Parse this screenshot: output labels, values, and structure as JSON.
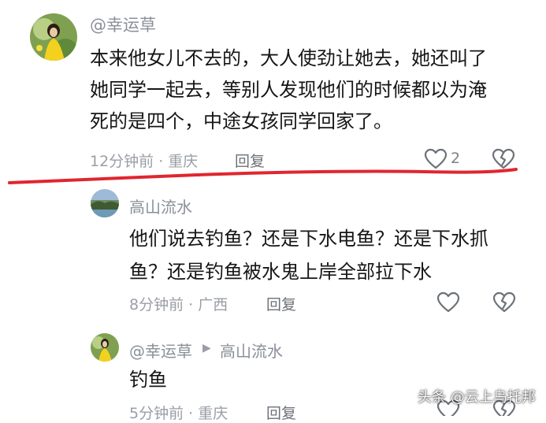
{
  "comment": {
    "username": "@幸运草",
    "text_lines": [
      "本来他女儿不去的，大人使劲让她去，她还叫了",
      "她同学一起去，等别人发现他们的时候都以为淹",
      "死的是四个，中途女孩同学回家了。"
    ],
    "meta": "12分钟前 · 重庆",
    "reply_label": "回复",
    "like_count": "2",
    "like_icon": "heart-outline-icon",
    "dislike_icon": "broken-heart-icon"
  },
  "reply1": {
    "username": "高山流水",
    "text_lines": [
      "他们说去钓鱼？还是下水电鱼？还是下水抓",
      "鱼？还是钓鱼被水鬼上岸全部拉下水"
    ],
    "meta": "8分钟前 · 广西",
    "reply_label": "回复"
  },
  "reply2": {
    "username": "@幸运草",
    "reply_to": "高山流水",
    "text": "钓鱼",
    "meta": "5分钟前 · 重庆",
    "reply_label": "回复"
  },
  "watermark": {
    "line1": "头条 @云上乌托邦"
  },
  "colors": {
    "annotation_line": "#e0262f",
    "meta_text": "#9a9ea6",
    "username_text": "#8a8f99"
  }
}
